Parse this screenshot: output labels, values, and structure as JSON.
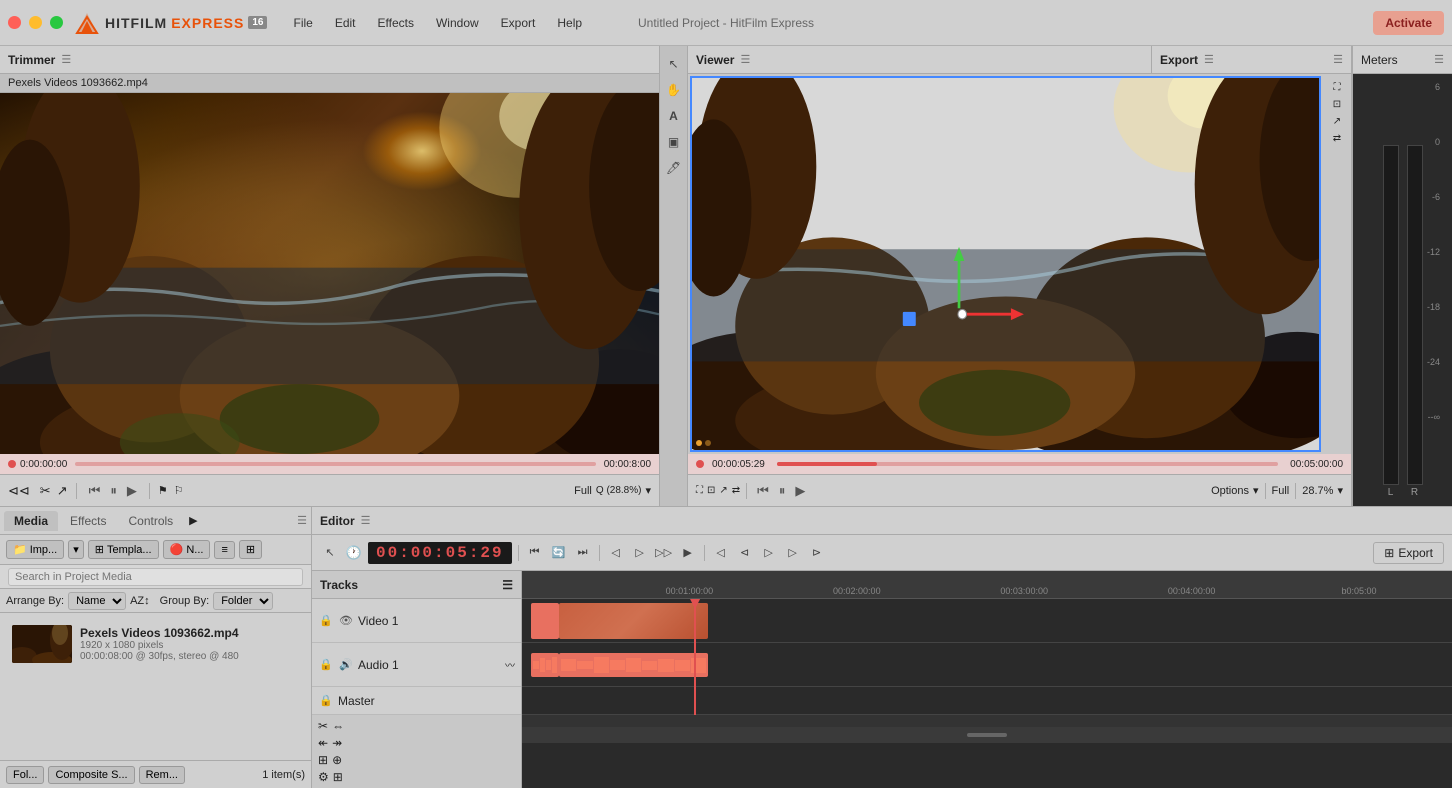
{
  "app": {
    "title": "Untitled Project - HitFilm Express",
    "version_badge": "16",
    "activate_btn": "Activate"
  },
  "menu": {
    "items": [
      "File",
      "Edit",
      "Effects",
      "Window",
      "Export",
      "Help"
    ]
  },
  "logo": {
    "hitfilm": "HITFILM",
    "express": "EXPRESS"
  },
  "trimmer": {
    "title": "Trimmer",
    "filename": "Pexels Videos 1093662.mp4",
    "time_start": "0:00:00:00",
    "time_end": "00:00:8:00"
  },
  "viewer": {
    "title": "Viewer",
    "time": "00:00:05:29",
    "time_end": "00:05:00:00",
    "options_label": "Options",
    "full_label": "Full",
    "zoom_label": "28.7%"
  },
  "export_panel": {
    "title": "Export"
  },
  "editor": {
    "title": "Editor",
    "timecode": "00:00:05:29",
    "export_btn": "Export",
    "tracks_label": "Tracks",
    "tracks": [
      {
        "name": "Video 1",
        "type": "video"
      },
      {
        "name": "Audio 1",
        "type": "audio"
      },
      {
        "name": "Master",
        "type": "master"
      }
    ],
    "time_marks": [
      "00:01:00:00",
      "00:02:00:00",
      "00:03:00:00",
      "00:04:00:00",
      "b0:05:00"
    ]
  },
  "left_panel": {
    "tabs": [
      "Media",
      "Effects",
      "Controls"
    ],
    "active_tab": "Media",
    "import_btn": "Imp...",
    "template_btn": "Templa...",
    "new_btn": "N...",
    "search_placeholder": "Search in Project Media",
    "arrange_label": "Arrange By:",
    "arrange_value": "Name",
    "group_label": "Group By:",
    "group_value": "Folder",
    "media_items": [
      {
        "name": "Pexels Videos 1093662.mp4",
        "resolution": "1920 x 1080 pixels",
        "duration": "00:00:08:00 @ 30fps, stereo @ 480"
      }
    ],
    "bottom_items": [
      "Fol...",
      "Composite S...",
      "Rem..."
    ],
    "item_count": "1 item(s)"
  },
  "meters": {
    "title": "Meters",
    "scale": [
      "6",
      "0",
      "-6",
      "-12",
      "-18",
      "-24",
      "--∞"
    ],
    "l_label": "L",
    "r_label": "R"
  },
  "trimmer_controls": {
    "zoom_label": "Full",
    "zoom_pct": "Q (28.8%)"
  }
}
